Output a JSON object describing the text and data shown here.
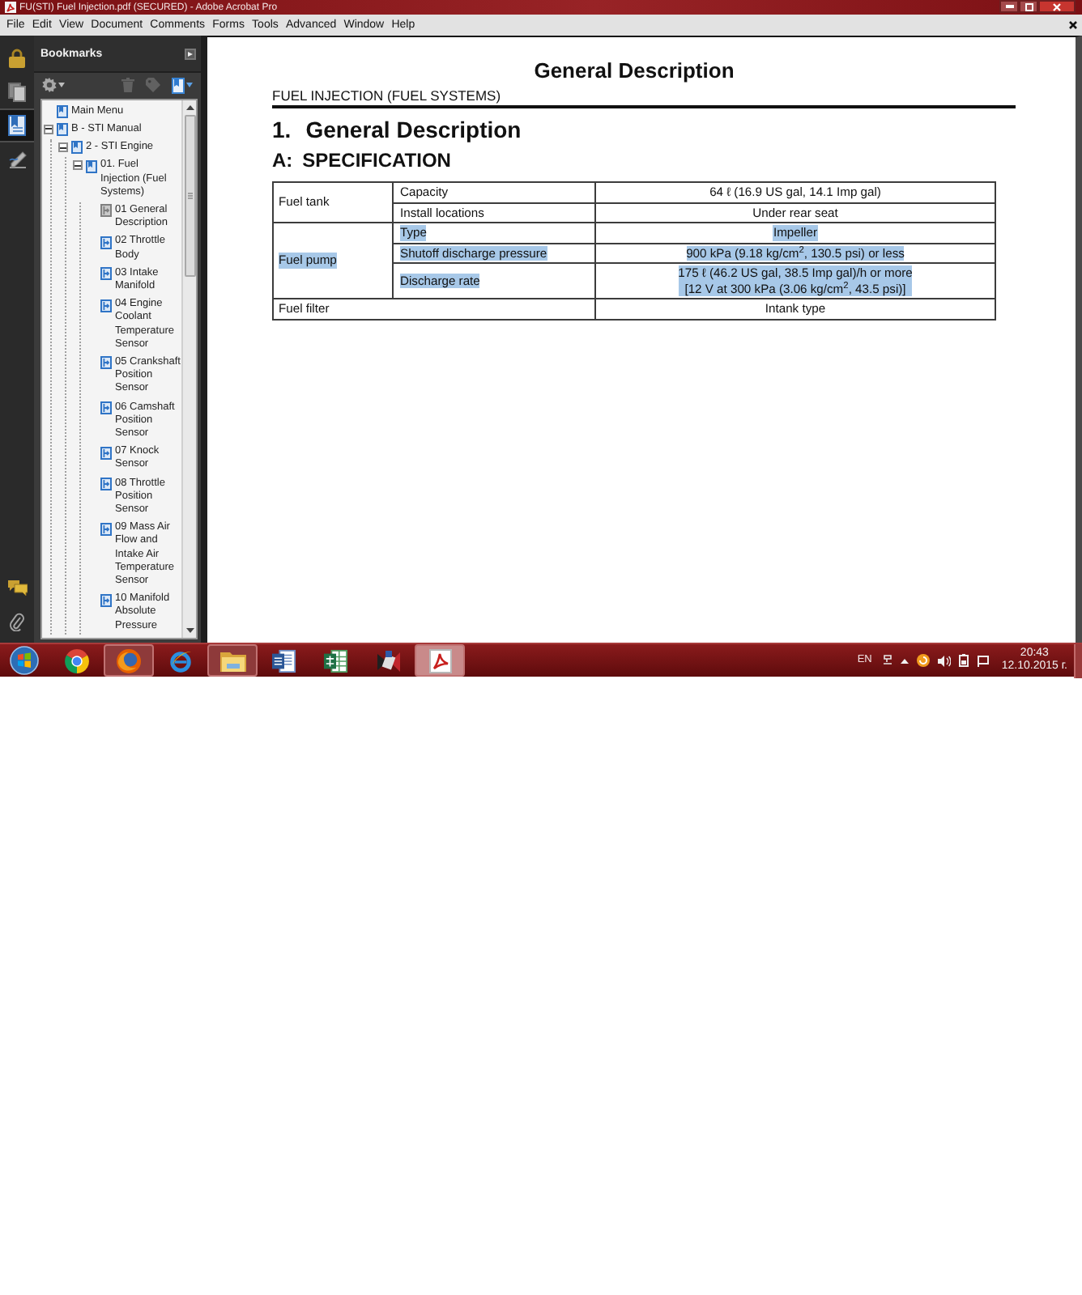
{
  "window": {
    "title": "FU(STI) Fuel Injection.pdf (SECURED) - Adobe Acrobat Pro"
  },
  "menu": [
    "File",
    "Edit",
    "View",
    "Document",
    "Comments",
    "Forms",
    "Tools",
    "Advanced",
    "Window",
    "Help"
  ],
  "nav_rail": [
    {
      "selected": false
    },
    {
      "selected": false
    },
    {
      "selected": true
    },
    {
      "selected": false
    }
  ],
  "bookmarks_panel": {
    "title": "Bookmarks",
    "toolbar": [
      {
        "disabled": false
      },
      {
        "disabled": true
      },
      {
        "disabled": true
      },
      {
        "disabled": false
      }
    ],
    "tree": [
      {
        "label": "Main Menu",
        "current": false
      },
      {
        "label": "B - STI Manual",
        "current": false,
        "expanded": true,
        "children": [
          {
            "label": "2 - STI Engine",
            "current": false,
            "expanded": true,
            "children": [
              {
                "label": "01. Fuel Injection (Fuel Systems)",
                "current": false,
                "expanded": true,
                "children": [
                  {
                    "label": "01 General Description",
                    "current": true
                  },
                  {
                    "label": "02 Throttle Body",
                    "current": false
                  },
                  {
                    "label": "03 Intake Manifold",
                    "current": false
                  },
                  {
                    "label": "04 Engine Coolant Temperature Sensor",
                    "current": false
                  },
                  {
                    "label": "05 Crankshaft Position Sensor",
                    "current": false
                  },
                  {
                    "label": "06 Camshaft Position Sensor",
                    "current": false
                  },
                  {
                    "label": "07 Knock Sensor",
                    "current": false
                  },
                  {
                    "label": "08 Throttle Position Sensor",
                    "current": false
                  },
                  {
                    "label": "09 Mass Air Flow and Intake Air Temperature Sensor",
                    "current": false
                  },
                  {
                    "label": "10 Manifold Absolute Pressure",
                    "current": false
                  }
                ]
              }
            ]
          }
        ]
      }
    ]
  },
  "document": {
    "page_title": "General Description",
    "section": "FUEL INJECTION (FUEL SYSTEMS)",
    "heading": {
      "number": "1.",
      "text": "General Description"
    },
    "subheading": {
      "number": "A:",
      "text": "SPECIFICATION"
    },
    "table": {
      "groups": [
        {
          "label": "Fuel tank",
          "highlighted": false,
          "specs": [
            {
              "name": "Capacity",
              "value": [
                "64 ℓ (16.9 US gal, 14.1 Imp gal)"
              ],
              "highlighted": false
            },
            {
              "name": "Install locations",
              "value": [
                "Under rear seat"
              ],
              "highlighted": false
            }
          ]
        },
        {
          "label": "Fuel pump",
          "highlighted": true,
          "specs": [
            {
              "name": "Type",
              "value": [
                "Impeller"
              ],
              "highlighted": true
            },
            {
              "name": "Shutoff discharge pressure",
              "value": [
                "900 kPa (9.18 kg/cm$^{2}$, 130.5 psi) or less"
              ],
              "highlighted": true
            },
            {
              "name": "Discharge rate",
              "value": [
                "175 ℓ (46.2 US gal, 38.5 Imp gal)/h or more",
                "[12 V at 300 kPa (3.06 kg/cm$^{2}$, 43.5 psi)]"
              ],
              "highlighted": true
            }
          ]
        },
        {
          "label": "Fuel filter",
          "highlighted": false,
          "value": [
            "Intank type"
          ]
        }
      ]
    }
  },
  "taskbar": {
    "apps": [
      {
        "running": false,
        "active": false
      },
      {
        "running": true,
        "active": false
      },
      {
        "running": false,
        "active": false
      },
      {
        "running": true,
        "active": false
      },
      {
        "running": false,
        "active": false
      },
      {
        "running": false,
        "active": false
      },
      {
        "running": false,
        "active": false
      },
      {
        "running": true,
        "active": true
      }
    ],
    "language": "EN",
    "time": "20:43",
    "date": "12.10.2015 г."
  }
}
